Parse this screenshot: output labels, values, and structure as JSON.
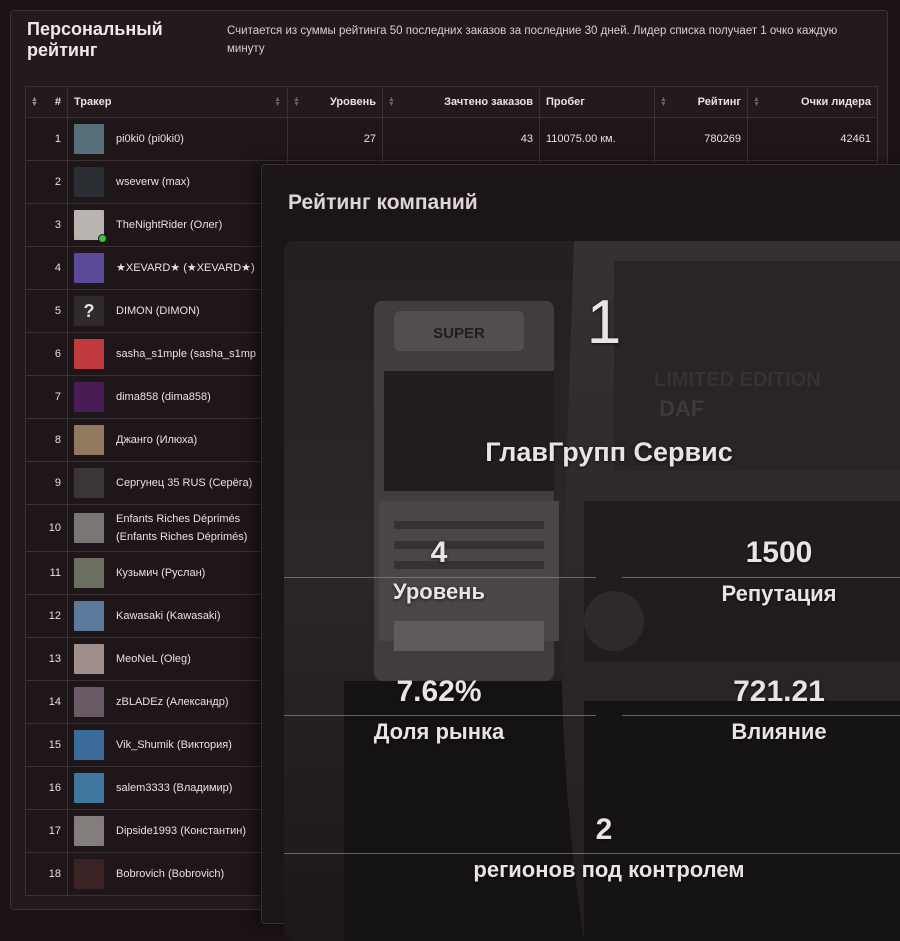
{
  "personal": {
    "title": "Персональный рейтинг",
    "description": "Считается из суммы рейтинга 50 последних заказов за последние 30 дней. Лидер списка получает 1 очко каждую минуту",
    "columns": {
      "index": "#",
      "tracker": "Тракер",
      "level": "Уровень",
      "credited": "Зачтено заказов",
      "mileage": "Пробег",
      "rating": "Рейтинг",
      "leader_points": "Очки лидера"
    },
    "rows": [
      {
        "n": "1",
        "name": "pi0ki0 (pi0ki0)",
        "level": "27",
        "credited": "43",
        "mileage": "110075.00 км.",
        "rating": "780269",
        "points": "42461",
        "avatar_color": "#55707a"
      },
      {
        "n": "2",
        "name": "wseverw (max)",
        "avatar_color": "#2b2f33"
      },
      {
        "n": "3",
        "name": "TheNightRider (Олег)",
        "avatar_color": "#b9b4b0"
      },
      {
        "n": "4",
        "name": "★XEVARD★ (★XEVARD★)",
        "avatar_color": "#5b4a9a"
      },
      {
        "n": "5",
        "name": "DIMON (DIMON)",
        "avatar_color": "#2f2a2c",
        "avatar_glyph": "?"
      },
      {
        "n": "6",
        "name": "sasha_s1mple (sasha_s1mp",
        "avatar_color": "#c23a40"
      },
      {
        "n": "7",
        "name": "dima858 (dima858)",
        "avatar_color": "#4a1c55"
      },
      {
        "n": "8",
        "name": "Джанго (Илюха)",
        "avatar_color": "#8f7a60"
      },
      {
        "n": "9",
        "name": "Сергунец 35 RUS (Серёга)",
        "avatar_color": "#3a3538"
      },
      {
        "n": "10",
        "name": "Enfants Riches Déprimés (Enfants Riches Déprimés)",
        "avatar_color": "#7a7674"
      },
      {
        "n": "11",
        "name": "Кузьмич (Руслан)",
        "avatar_color": "#6c6f60"
      },
      {
        "n": "12",
        "name": "Kawasaki (Kawasaki)",
        "avatar_color": "#5d7a9c"
      },
      {
        "n": "13",
        "name": "MeoNeL (Oleg)",
        "avatar_color": "#a08f8c"
      },
      {
        "n": "14",
        "name": "zBLADEz (Александр)",
        "avatar_color": "#6a5a66"
      },
      {
        "n": "15",
        "name": "Vik_Shumik (Виктория)",
        "avatar_color": "#3b6b9a"
      },
      {
        "n": "16",
        "name": "salem3333 (Владимир)",
        "avatar_color": "#3e78a0"
      },
      {
        "n": "17",
        "name": "Dipside1993 (Константин)",
        "avatar_color": "#837e7c"
      },
      {
        "n": "18",
        "name": "Bobrovich (Bobrovich)",
        "avatar_color": "#3a2225"
      }
    ]
  },
  "company": {
    "title": "Рейтинг компаний",
    "rank": "1",
    "name": "ГлавГрупп Сервис",
    "level_value": "4",
    "level_label": "Уровень",
    "reputation_value": "1500",
    "reputation_label": "Репутация",
    "market_value": "7.62%",
    "market_label": "Доля рынка",
    "influence_value": "721.21",
    "influence_label": "Влияние",
    "regions_value": "2",
    "regions_label": "регионов под контролем"
  },
  "colors": {
    "background": "#1a1214",
    "panel": "#231a1c",
    "border": "#3b3033",
    "text": "#e6e0e0",
    "online": "#3ec23e"
  }
}
